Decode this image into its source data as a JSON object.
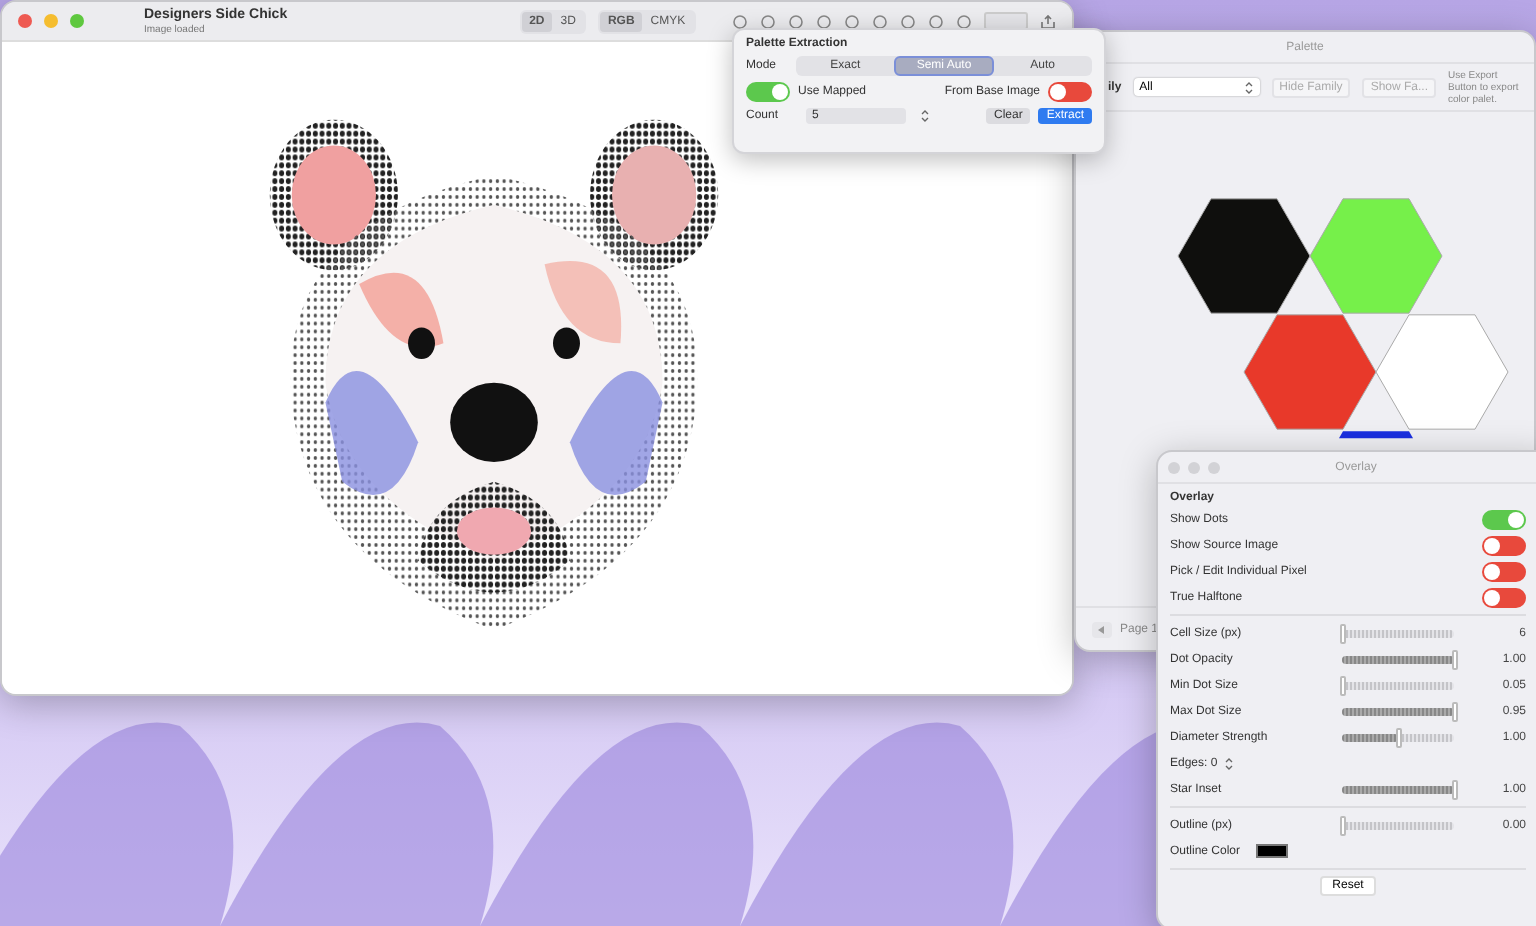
{
  "main_window": {
    "title": "Designers Side Chick",
    "subtitle": "Image loaded",
    "view_modes": [
      {
        "label": "2D",
        "selected": true
      },
      {
        "label": "3D",
        "selected": false
      }
    ],
    "color_modes": [
      {
        "label": "RGB",
        "selected": true
      },
      {
        "label": "CMYK",
        "selected": false
      }
    ]
  },
  "palette_extraction": {
    "title": "Palette Extraction",
    "mode_label": "Mode",
    "modes": [
      {
        "label": "Exact",
        "selected": false
      },
      {
        "label": "Semi Auto",
        "selected": true
      },
      {
        "label": "Auto",
        "selected": false
      }
    ],
    "use_mapped": {
      "label": "Use Mapped",
      "on": true
    },
    "from_base_image": {
      "label": "From Base Image",
      "on": false
    },
    "count_label": "Count",
    "count_value": "5",
    "clear_button": "Clear",
    "extract_button": "Extract"
  },
  "palette_window": {
    "title": "Palette",
    "family_label": "ily",
    "family_value": "All",
    "hide_family_button": "Hide Family",
    "show_family_button": "Show Fa...",
    "note": "Use Export Button to export color palet.",
    "swatches": [
      {
        "color": "#0f0f0d"
      },
      {
        "color": "#76f04a"
      },
      {
        "color": "#e8392a"
      },
      {
        "color": "#ffffff"
      },
      {
        "color": "#1a2fe0"
      }
    ],
    "page_label": "Page 1"
  },
  "overlay_window": {
    "title": "Overlay",
    "heading": "Overlay",
    "sections": [
      [
        {
          "kind": "toggle",
          "label": "Show Dots",
          "on": true
        },
        {
          "kind": "toggle",
          "label": "Show Source Image",
          "on": false
        },
        {
          "kind": "toggle",
          "label": "Pick / Edit Individual Pixel",
          "on": false
        },
        {
          "kind": "toggle",
          "label": "True Halftone",
          "on": false
        }
      ],
      [
        {
          "kind": "slider",
          "label": "Cell Size (px)",
          "level": 0.0,
          "reading": "6"
        },
        {
          "kind": "slider",
          "label": "Dot Opacity",
          "level": 1.0,
          "reading": "1.00"
        },
        {
          "kind": "slider",
          "label": "Min Dot Size",
          "level": 0.0,
          "reading": "0.05"
        },
        {
          "kind": "slider",
          "label": "Max Dot Size",
          "level": 1.0,
          "reading": "0.95"
        },
        {
          "kind": "slider",
          "label": "Diameter Strength",
          "level": 0.5,
          "reading": "1.00"
        },
        {
          "kind": "stepper",
          "label": "Edges: 0"
        },
        {
          "kind": "slider",
          "label": "Star Inset",
          "level": 1.0,
          "reading": "1.00"
        }
      ],
      [
        {
          "kind": "slider",
          "label": "Outline (px)",
          "level": 0.0,
          "reading": "0.00"
        },
        {
          "kind": "color",
          "label": "Outline Color",
          "color": "#000000"
        }
      ]
    ],
    "reset_button": "Reset"
  }
}
